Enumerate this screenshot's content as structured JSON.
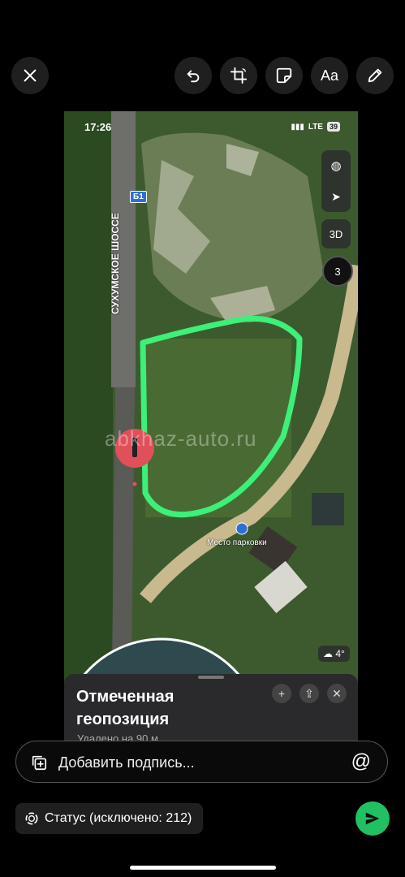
{
  "toolbar": {
    "close_icon": "close-icon",
    "undo_icon": "undo-icon",
    "crop_icon": "crop-icon",
    "sticker_icon": "sticker-icon",
    "text_label": "Aa",
    "draw_icon": "pencil-icon"
  },
  "photo": {
    "status_time": "17:26",
    "network": "LTE",
    "battery": "39",
    "road_badge": "Б1",
    "road_name": "СУХУМСКОЕ ШОССЕ",
    "parking_label": "Место парковки",
    "watermark": "abkhaz-auto.ru",
    "map_3d_label": "3D",
    "compass_value": "3",
    "weather_temp": "4°",
    "sheet_title": "Отмеченная геопозиция",
    "sheet_subtitle": "Удалено на 90 м"
  },
  "caption": {
    "placeholder": "Добавить подпись...",
    "at_label": "@"
  },
  "status": {
    "label": "Статус (исключено: 212)"
  },
  "colors": {
    "outline": "#3cf07a",
    "send": "#21c063",
    "pin": "#e0505a"
  }
}
